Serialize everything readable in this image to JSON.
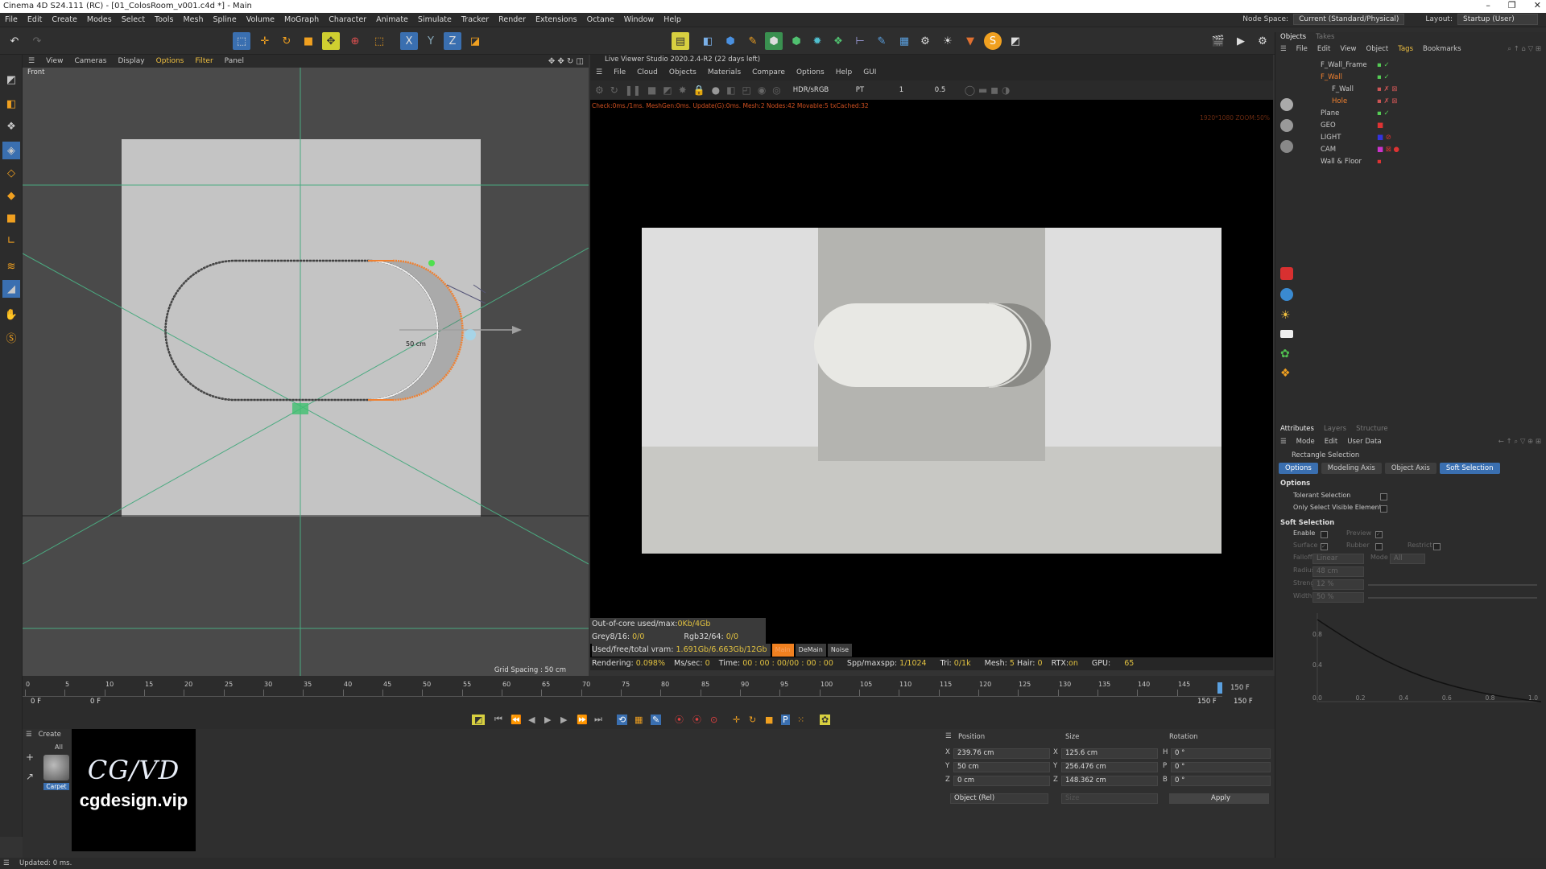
{
  "window": {
    "title": "Cinema 4D S24.111 (RC) - [01_ColosRoom_v001.c4d *] - Main",
    "controls": [
      "–",
      "❐",
      "✕"
    ]
  },
  "menu": {
    "items": [
      "File",
      "Edit",
      "Create",
      "Modes",
      "Select",
      "Tools",
      "Mesh",
      "Spline",
      "Volume",
      "MoGraph",
      "Character",
      "Animate",
      "Simulate",
      "Tracker",
      "Render",
      "Extensions",
      "Octane",
      "Window",
      "Help"
    ],
    "node_space_label": "Node Space:",
    "node_space_value": "Current (Standard/Physical)",
    "layout_label": "Layout:",
    "layout_value": "Startup (User)"
  },
  "viewport": {
    "menu": [
      "View",
      "Cameras",
      "Display",
      "Options",
      "Filter",
      "Panel"
    ],
    "view_name": "Front",
    "dimension_label": "50 cm",
    "grid_spacing": "Grid Spacing : 50 cm"
  },
  "live_viewer": {
    "title": "Live Viewer Studio 2020.2.4-R2 (22 days left)",
    "menu": [
      "File",
      "Cloud",
      "Objects",
      "Materials",
      "Compare",
      "Options",
      "Help",
      "GUI"
    ],
    "color_mode": "HDR/sRGB",
    "render_mode": "PT",
    "value_1": "1",
    "value_2": "0.5",
    "check_line": "Check:0ms./1ms. MeshGen:0ms. Update(G):0ms. Mesh:2 Nodes:42 Movable:5 txCached:32",
    "resolution": "1920*1080 ZOOM:50%",
    "stats": {
      "out_of_core_label": "Out-of-core used/max:",
      "out_of_core_value": "0Kb/4Gb",
      "grey_label": "Grey8/16:",
      "grey_value": "0/0",
      "rgb_label": "Rgb32/64:",
      "rgb_value": "0/0",
      "vram_label": "Used/free/total vram:",
      "vram_value": "1.691Gb/6.663Gb/12Gb",
      "main_btn": "Main",
      "demain_btn": "DeMain",
      "noise_btn": "Noise",
      "rendering_label": "Rendering:",
      "rendering_value": "0.098%",
      "mssec_label": "Ms/sec:",
      "mssec_value": "0",
      "time_label": "Time:",
      "time_value": "00 : 00 : 00/00 : 00 : 00",
      "spp_label": "Spp/maxspp:",
      "spp_value": "1/1024",
      "tri_label": "Tri:",
      "tri_value": "0/1k",
      "mesh_label": "Mesh:",
      "mesh_value": "5",
      "hair_label": "Hair:",
      "hair_value": "0",
      "rtx_label": "RTX:",
      "rtx_value": "on",
      "gpu_label": "GPU:",
      "gpu_value": "65"
    }
  },
  "objects_panel": {
    "tabs": [
      "Objects",
      "Takes"
    ],
    "menu": [
      "File",
      "Edit",
      "View",
      "Object",
      "Tags",
      "Bookmarks"
    ],
    "items": [
      {
        "name": "F_Wall_Frame",
        "indent": 0
      },
      {
        "name": "F_Wall",
        "indent": 0
      },
      {
        "name": "F_Wall",
        "indent": 1
      },
      {
        "name": "Hole",
        "indent": 1
      },
      {
        "name": "Plane",
        "indent": 0
      },
      {
        "name": "GEO",
        "indent": 0
      },
      {
        "name": "LIGHT",
        "indent": 0
      },
      {
        "name": "CAM",
        "indent": 0
      },
      {
        "name": "Wall & Floor",
        "indent": 0
      }
    ]
  },
  "attributes": {
    "tabs": [
      "Attributes",
      "Layers",
      "Structure"
    ],
    "menu": [
      "Mode",
      "Edit",
      "User Data"
    ],
    "tool_name": "Rectangle Selection",
    "subtabs": [
      "Options",
      "Modeling Axis",
      "Object Axis",
      "Soft Selection"
    ],
    "options_header": "Options",
    "tolerant_selection": "Tolerant Selection",
    "only_visible": "Only Select Visible Elements",
    "soft_header": "Soft Selection",
    "enable": "Enable",
    "preview": "Preview",
    "surface": "Surface",
    "rubber": "Rubber",
    "restrict": "Restrict",
    "falloff": "Falloff",
    "falloff_value": "Linear",
    "mode": "Mode",
    "mode_value": "All",
    "radius": "Radius",
    "radius_value": "48 cm",
    "strength": "Strength",
    "strength_value": "12 %",
    "width": "Width",
    "width_value": "50 %",
    "graph_y": [
      "0.8",
      "0.4"
    ],
    "graph_x": [
      "0.0",
      "0.2",
      "0.4",
      "0.6",
      "0.8",
      "1.0"
    ]
  },
  "timeline": {
    "ticks": [
      "0",
      "5",
      "10",
      "15",
      "20",
      "25",
      "30",
      "35",
      "40",
      "45",
      "50",
      "55",
      "60",
      "65",
      "70",
      "75",
      "80",
      "85",
      "90",
      "95",
      "100",
      "105",
      "110",
      "115",
      "120",
      "125",
      "130",
      "135",
      "140",
      "145"
    ],
    "end_frame": "150 F",
    "start_field": "0 F",
    "start_field2": "0 F",
    "end_field": "150 F",
    "end_field2": "150 F"
  },
  "material_panel": {
    "menu": [
      "Create"
    ],
    "filter": "All",
    "material_name": "Carpet"
  },
  "coordinates": {
    "headers": [
      "Position",
      "Size",
      "Rotation"
    ],
    "rows": [
      {
        "axis": "X",
        "pos": "239.76 cm",
        "size_axis": "X",
        "size": "125.6 cm",
        "rot_axis": "H",
        "rot": "0 °"
      },
      {
        "axis": "Y",
        "pos": "50 cm",
        "size_axis": "Y",
        "size": "256.476 cm",
        "rot_axis": "P",
        "rot": "0 °"
      },
      {
        "axis": "Z",
        "pos": "0 cm",
        "size_axis": "Z",
        "size": "148.362 cm",
        "rot_axis": "B",
        "rot": "0 °"
      }
    ],
    "mode_value": "Object (Rel)",
    "size_mode": "Size",
    "apply": "Apply"
  },
  "watermark": {
    "logo": "CG/VD",
    "site": "cgdesign.vip"
  },
  "status": "Updated: 0 ms."
}
